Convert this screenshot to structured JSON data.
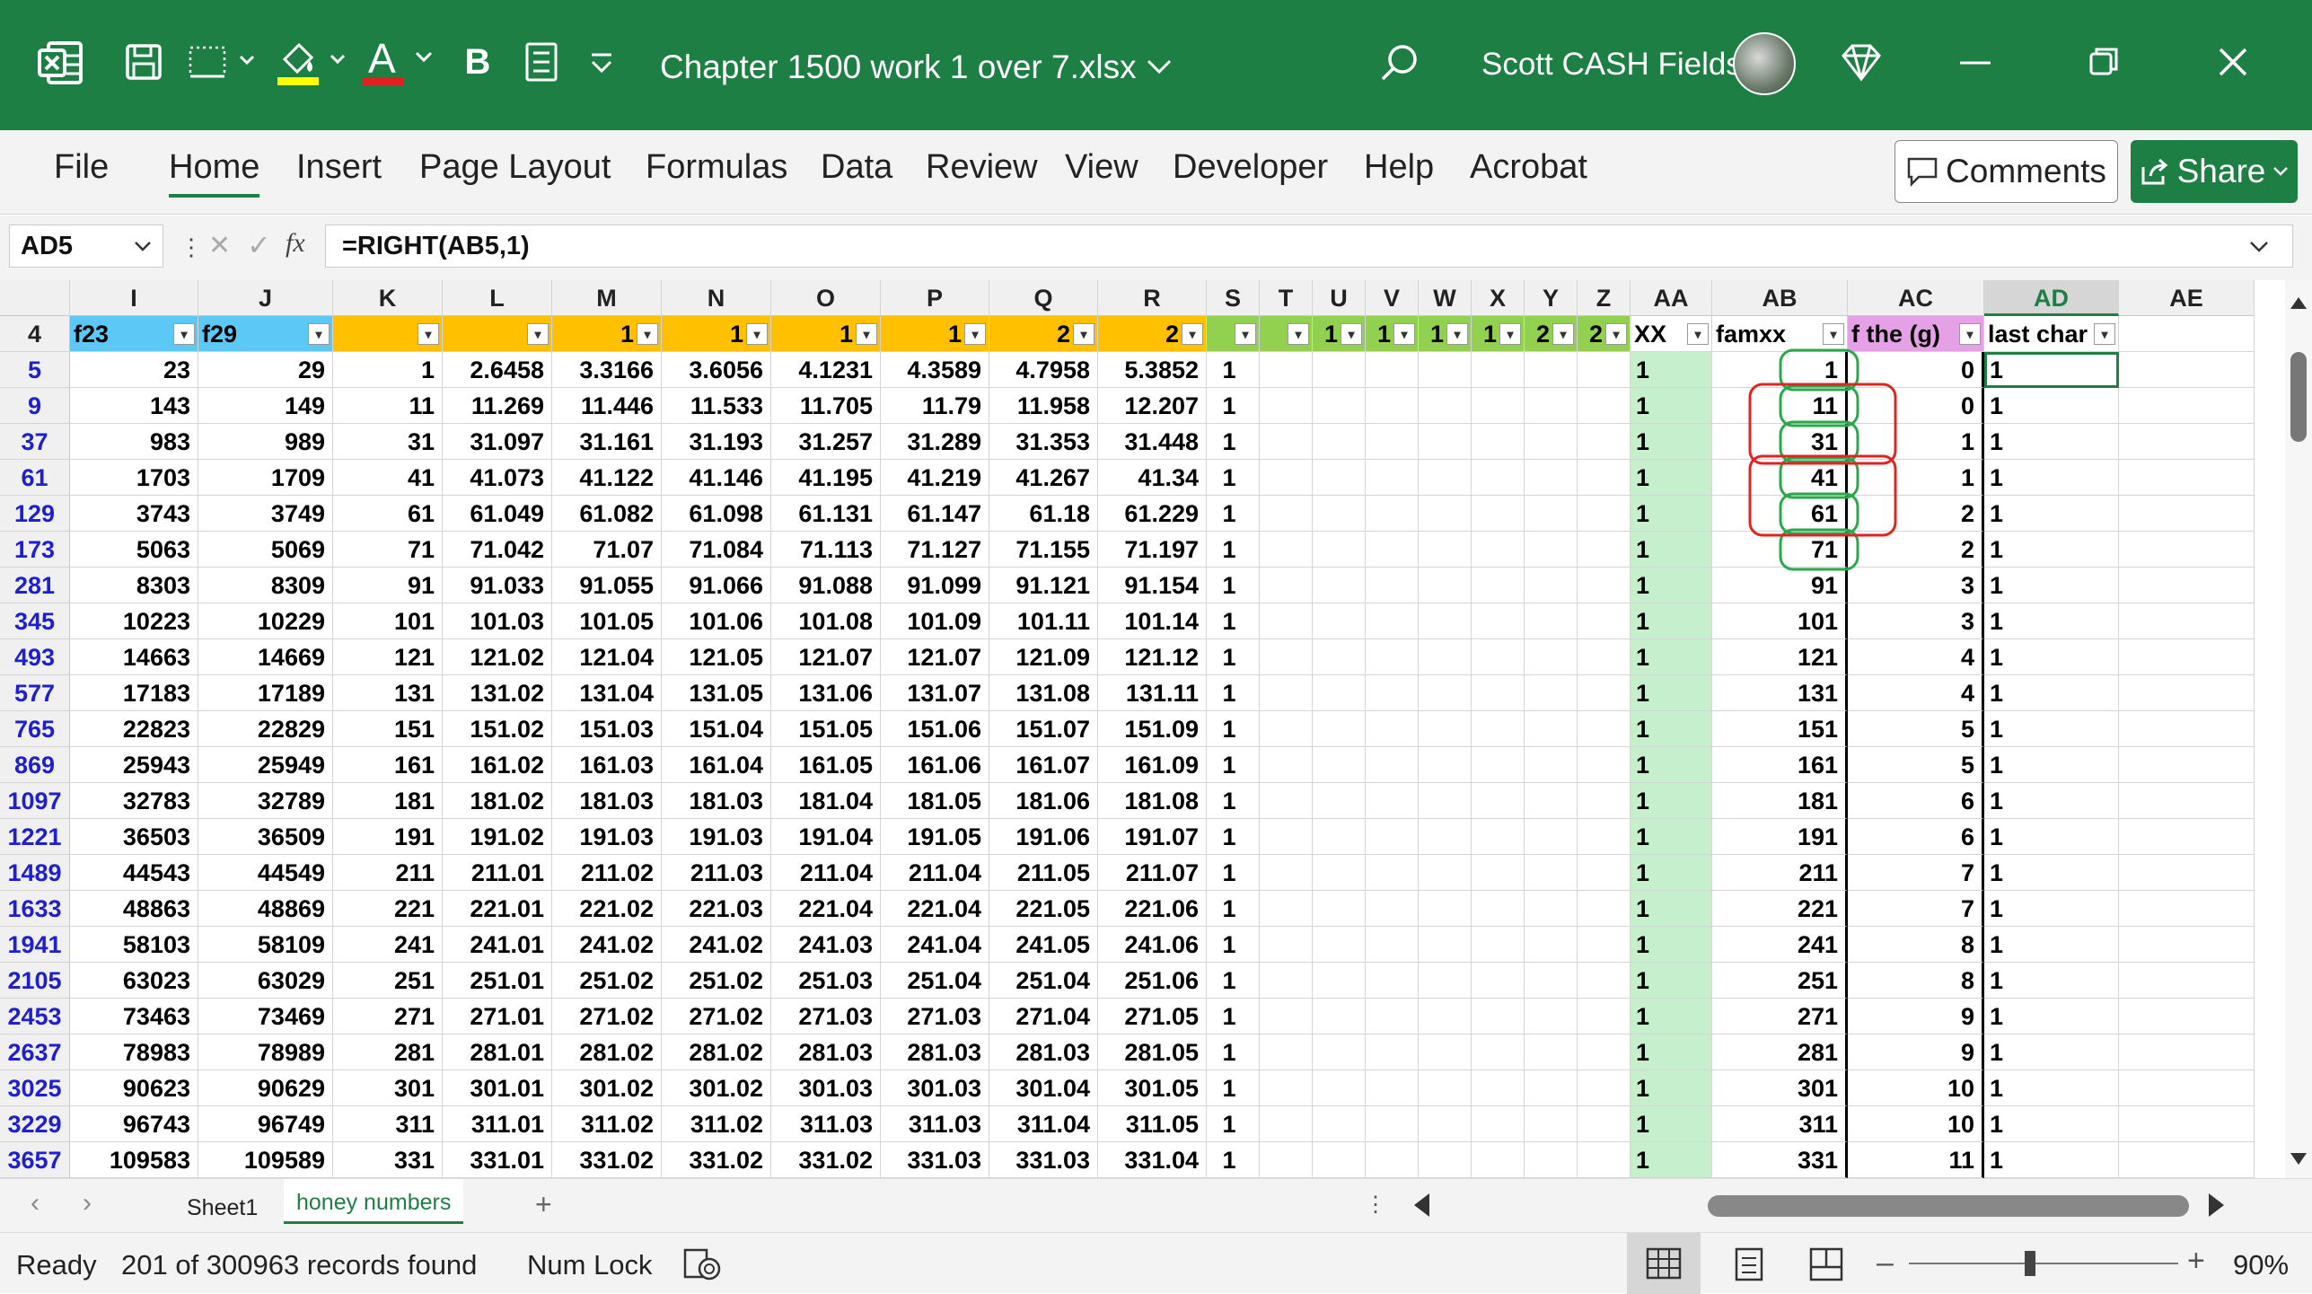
{
  "titlebar": {
    "filename": "Chapter 1500 work 1 over 7.xlsx",
    "user": "Scott CASH Fields",
    "bg_color": "#1e7f45",
    "icons": [
      "excel-logo-icon",
      "save-icon",
      "borders-icon",
      "fill-color-icon",
      "font-color-icon",
      "bold-icon",
      "form-icon",
      "customize-icon",
      "search-icon",
      "diamond-icon",
      "minimize-icon",
      "restore-icon",
      "close-icon"
    ],
    "bold_label": "B",
    "font_color_label": "A"
  },
  "ribbon": {
    "tabs": [
      "File",
      "Home",
      "Insert",
      "Page Layout",
      "Formulas",
      "Data",
      "Review",
      "View",
      "Developer",
      "Help",
      "Acrobat"
    ],
    "active_tab": "Home",
    "comments_label": "Comments",
    "share_label": "Share"
  },
  "formula_bar": {
    "name_box": "AD5",
    "fx": "fx",
    "formula": "=RIGHT(AB5,1)"
  },
  "grid": {
    "header_row_number": "4",
    "columns": [
      "I",
      "J",
      "K",
      "L",
      "M",
      "N",
      "O",
      "P",
      "Q",
      "R",
      "S",
      "T",
      "U",
      "V",
      "W",
      "X",
      "Y",
      "Z",
      "AA",
      "AB",
      "AC",
      "AD",
      "AE"
    ],
    "filter_headers": [
      "f23",
      "f29",
      "",
      "",
      "1",
      "1",
      "1",
      "1",
      "2",
      "2",
      "",
      "",
      "1",
      "1",
      "1",
      "1",
      "2",
      "2",
      "XX",
      "famxx",
      "f the (g)",
      "last char",
      ""
    ],
    "row_numbers": [
      "5",
      "9",
      "37",
      "61",
      "129",
      "173",
      "281",
      "345",
      "493",
      "577",
      "765",
      "869",
      "1097",
      "1221",
      "1489",
      "1633",
      "1941",
      "2105",
      "2453",
      "2637",
      "3025",
      "3229",
      "3657"
    ],
    "rows": [
      [
        "23",
        "29",
        "1",
        "2.6458",
        "3.3166",
        "3.6056",
        "4.1231",
        "4.3589",
        "4.7958",
        "5.3852",
        "1",
        "1",
        "1",
        "0",
        "1"
      ],
      [
        "143",
        "149",
        "11",
        "11.269",
        "11.446",
        "11.533",
        "11.705",
        "11.79",
        "11.958",
        "12.207",
        "1",
        "1",
        "11",
        "0",
        "1"
      ],
      [
        "983",
        "989",
        "31",
        "31.097",
        "31.161",
        "31.193",
        "31.257",
        "31.289",
        "31.353",
        "31.448",
        "1",
        "1",
        "31",
        "1",
        "1"
      ],
      [
        "1703",
        "1709",
        "41",
        "41.073",
        "41.122",
        "41.146",
        "41.195",
        "41.219",
        "41.267",
        "41.34",
        "1",
        "1",
        "41",
        "1",
        "1"
      ],
      [
        "3743",
        "3749",
        "61",
        "61.049",
        "61.082",
        "61.098",
        "61.131",
        "61.147",
        "61.18",
        "61.229",
        "1",
        "1",
        "61",
        "2",
        "1"
      ],
      [
        "5063",
        "5069",
        "71",
        "71.042",
        "71.07",
        "71.084",
        "71.113",
        "71.127",
        "71.155",
        "71.197",
        "1",
        "1",
        "71",
        "2",
        "1"
      ],
      [
        "8303",
        "8309",
        "91",
        "91.033",
        "91.055",
        "91.066",
        "91.088",
        "91.099",
        "91.121",
        "91.154",
        "1",
        "1",
        "91",
        "3",
        "1"
      ],
      [
        "10223",
        "10229",
        "101",
        "101.03",
        "101.05",
        "101.06",
        "101.08",
        "101.09",
        "101.11",
        "101.14",
        "1",
        "1",
        "101",
        "3",
        "1"
      ],
      [
        "14663",
        "14669",
        "121",
        "121.02",
        "121.04",
        "121.05",
        "121.07",
        "121.07",
        "121.09",
        "121.12",
        "1",
        "1",
        "121",
        "4",
        "1"
      ],
      [
        "17183",
        "17189",
        "131",
        "131.02",
        "131.04",
        "131.05",
        "131.06",
        "131.07",
        "131.08",
        "131.11",
        "1",
        "1",
        "131",
        "4",
        "1"
      ],
      [
        "22823",
        "22829",
        "151",
        "151.02",
        "151.03",
        "151.04",
        "151.05",
        "151.06",
        "151.07",
        "151.09",
        "1",
        "1",
        "151",
        "5",
        "1"
      ],
      [
        "25943",
        "25949",
        "161",
        "161.02",
        "161.03",
        "161.04",
        "161.05",
        "161.06",
        "161.07",
        "161.09",
        "1",
        "1",
        "161",
        "5",
        "1"
      ],
      [
        "32783",
        "32789",
        "181",
        "181.02",
        "181.03",
        "181.03",
        "181.04",
        "181.05",
        "181.06",
        "181.08",
        "1",
        "1",
        "181",
        "6",
        "1"
      ],
      [
        "36503",
        "36509",
        "191",
        "191.02",
        "191.03",
        "191.03",
        "191.04",
        "191.05",
        "191.06",
        "191.07",
        "1",
        "1",
        "191",
        "6",
        "1"
      ],
      [
        "44543",
        "44549",
        "211",
        "211.01",
        "211.02",
        "211.03",
        "211.04",
        "211.04",
        "211.05",
        "211.07",
        "1",
        "1",
        "211",
        "7",
        "1"
      ],
      [
        "48863",
        "48869",
        "221",
        "221.01",
        "221.02",
        "221.03",
        "221.04",
        "221.04",
        "221.05",
        "221.06",
        "1",
        "1",
        "221",
        "7",
        "1"
      ],
      [
        "58103",
        "58109",
        "241",
        "241.01",
        "241.02",
        "241.02",
        "241.03",
        "241.04",
        "241.05",
        "241.06",
        "1",
        "1",
        "241",
        "8",
        "1"
      ],
      [
        "63023",
        "63029",
        "251",
        "251.01",
        "251.02",
        "251.02",
        "251.03",
        "251.04",
        "251.04",
        "251.06",
        "1",
        "1",
        "251",
        "8",
        "1"
      ],
      [
        "73463",
        "73469",
        "271",
        "271.01",
        "271.02",
        "271.02",
        "271.03",
        "271.03",
        "271.04",
        "271.05",
        "1",
        "1",
        "271",
        "9",
        "1"
      ],
      [
        "78983",
        "78989",
        "281",
        "281.01",
        "281.02",
        "281.02",
        "281.03",
        "281.03",
        "281.03",
        "281.05",
        "1",
        "1",
        "281",
        "9",
        "1"
      ],
      [
        "90623",
        "90629",
        "301",
        "301.01",
        "301.02",
        "301.02",
        "301.03",
        "301.03",
        "301.04",
        "301.05",
        "1",
        "1",
        "301",
        "10",
        "1"
      ],
      [
        "96743",
        "96749",
        "311",
        "311.01",
        "311.02",
        "311.02",
        "311.03",
        "311.03",
        "311.04",
        "311.05",
        "1",
        "1",
        "311",
        "10",
        "1"
      ],
      [
        "109583",
        "109589",
        "331",
        "331.01",
        "331.02",
        "331.02",
        "331.02",
        "331.03",
        "331.03",
        "331.04",
        "1",
        "1",
        "331",
        "11",
        "1"
      ]
    ],
    "colors": {
      "f_header": "#5bc8f5",
      "orange_header": "#ffc000",
      "green_header": "#92d050",
      "aa_fill": "#c6efce",
      "ac_header": "#e6a0e6",
      "row_num_text": "#1f1fd0",
      "green_circle": "#2aa84a",
      "red_circle": "#e02424"
    }
  },
  "sheets": {
    "tabs": [
      "Sheet1",
      "honey numbers"
    ],
    "active": "honey numbers",
    "add_label": "+"
  },
  "status": {
    "ready": "Ready",
    "records": "201 of 300963 records found",
    "num_lock": "Num Lock",
    "zoom": "90%"
  }
}
